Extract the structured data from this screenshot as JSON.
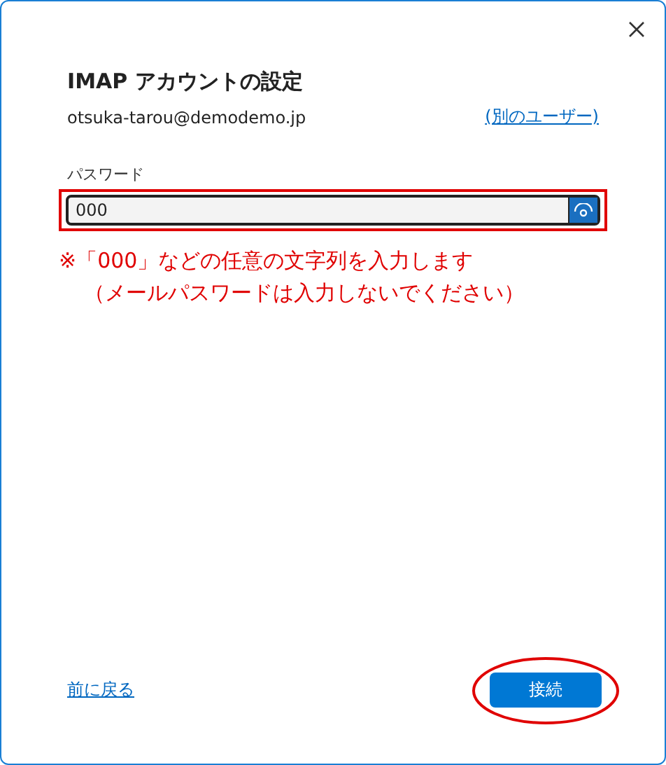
{
  "dialog": {
    "heading": "IMAP アカウントの設定",
    "account": "otsuka-tarou@demodemo.jp",
    "switch_user_link": "(別のユーザー)"
  },
  "password": {
    "label": "パスワード",
    "value": "000"
  },
  "note_lines": [
    "※「000」などの任意の文字列を入力します",
    "（メールパスワードは入力しないでください）"
  ],
  "footer": {
    "back_link": "前に戻る",
    "connect_button": "接続"
  }
}
